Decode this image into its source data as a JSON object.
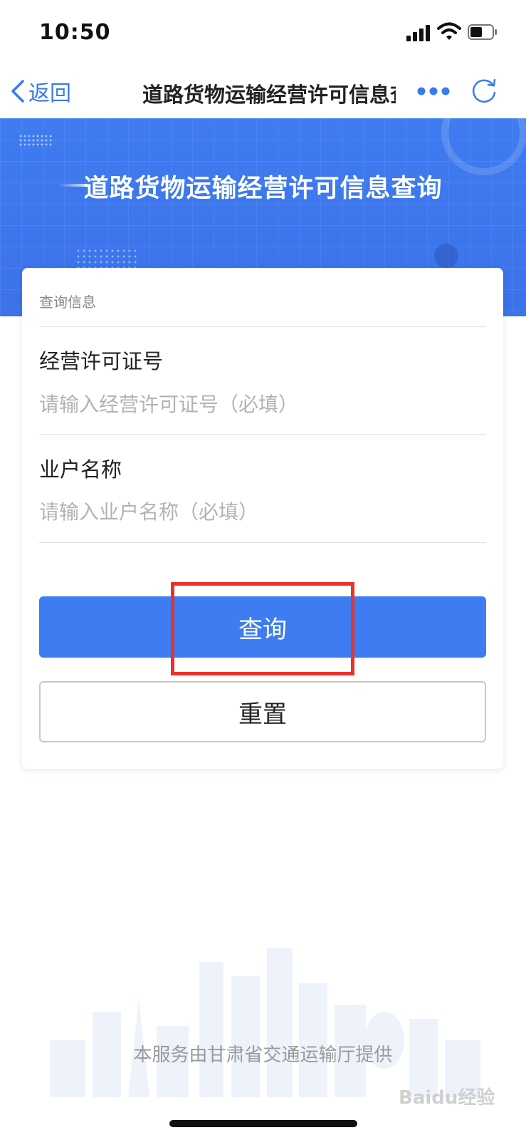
{
  "status_bar": {
    "time": "10:50"
  },
  "nav": {
    "back_label": "返回",
    "title": "道路货物运输经营许可信息查询"
  },
  "banner": {
    "title": "道路货物运输经营许可信息查询"
  },
  "form": {
    "section_label": "查询信息",
    "license_label": "经营许可证号",
    "license_value": "",
    "license_placeholder": "请输入经营许可证号（必填）",
    "owner_label": "业户名称",
    "owner_value": "",
    "owner_placeholder": "请输入业户名称（必填）",
    "query_label": "查询",
    "reset_label": "重置"
  },
  "footer": {
    "text": "本服务由甘肃省交通运输厅提供"
  },
  "watermark": {
    "text": "Baidu经验"
  },
  "colors": {
    "primary": "#3e7cf1",
    "banner": "#3f7cf0",
    "highlight": "#e8322c",
    "back": "#3a7af0"
  },
  "icons": [
    "chevron-left-icon",
    "more-icon",
    "refresh-icon",
    "signal-icon",
    "wifi-icon",
    "battery-icon"
  ]
}
